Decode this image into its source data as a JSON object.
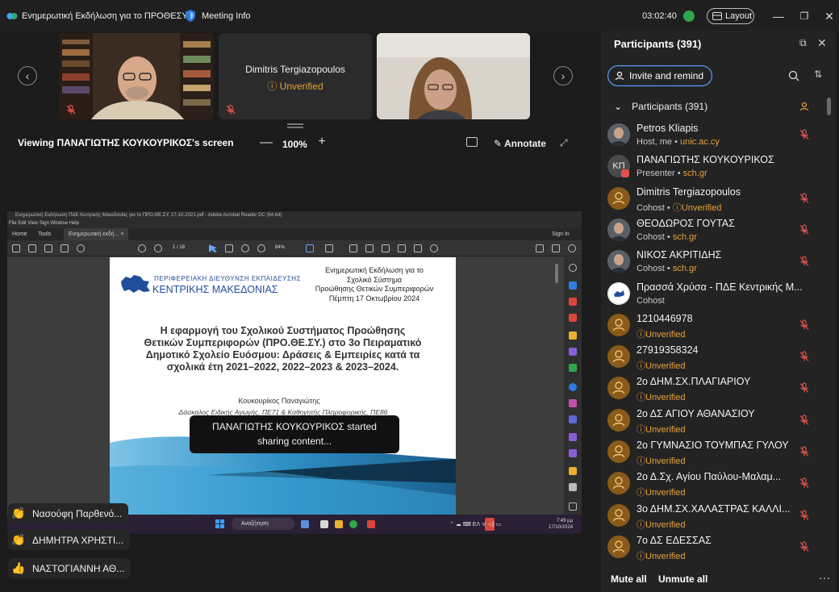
{
  "titlebar": {
    "app_title": "Ενημερωτική Εκδήλωση για το ΠΡΟΘΕΣΥ",
    "meeting_info": "Meeting Info",
    "timer": "03:02:40",
    "layout_label": "Layout",
    "minimize": "—",
    "maximize": "❐",
    "close": "✕"
  },
  "video_strip": {
    "prev_arrow": "‹",
    "next_arrow": "›",
    "tiles": [
      {
        "name": "",
        "muted": true
      },
      {
        "name": "Dimitris Tergiazopoulos",
        "status": "Unverified",
        "muted": true
      },
      {
        "name": "",
        "muted": false
      }
    ]
  },
  "viewing_bar": {
    "label": "Viewing ΠΑΝΑΓΙΩΤΗΣ ΚΟΥΚΟΥΡΙΚΟΣ's screen",
    "zoom_minus": "—",
    "zoom_value": "100%",
    "zoom_plus": "+",
    "annotate": "Annotate",
    "expand": "⤢"
  },
  "shared_screen": {
    "window_title": "Ενημερωτική Εκδήλωση ΠΔΕ Κεντρικής Μακεδονίας για το ΠΡΟ.ΘΕ.ΣΥ. 17-10-2021.pdf - Adobe Acrobat Reader DC (64-bit)",
    "menu": "File  Edit  View  Sign  Window  Help",
    "tabs": [
      "Home",
      "Tools",
      "Ενημερωτική εκδή..."
    ],
    "tab_close": "×",
    "sign_in": "Sign In",
    "page_indicator": "1  /  18",
    "zoom": "84%",
    "slide": {
      "region_line1": "ΠΕΡΙΦΕΡΕΙΑΚΗ ΔΙΕΥΘΥΝΣΗ ΕΚΠΑΙΔΕΥΣΗΣ",
      "region_line2": "ΚΕΝΤΡΙΚΗΣ ΜΑΚΕΔΟΝΙΑΣ",
      "event_lines": [
        "Ενημερωτική Εκδήλωση για το",
        "Σχολικό Σύστημα",
        "Προώθησης Θετικών Συμπεριφορών",
        "Πέμπτη 17 Οκτωβρίου 2024"
      ],
      "heading_lines": [
        "Η εφαρμογή του Σχολικού Συστήματος Προώθησης",
        "Θετικών Συμπεριφορών (ΠΡΟ.ΘΕ.ΣΥ.) στο 3ο Πειραματικό",
        "Δημοτικό Σχολείο Ευόσμου: Δράσεις & Εμπειρίες κατά τα",
        "σχολικά έτη 2021–2022, 2022–2023 & 2023–2024."
      ],
      "author": "Κουκουρίκος Παναγιώτης",
      "role": "Δάσκαλος Ειδικής Αγωγής, ΠΕ71 & Καθηγητής Πληροφορικής, ΠΕ86"
    },
    "toast": [
      "ΠΑΝΑΓΙΩΤΗΣ ΚΟΥΚΟΥΡΙΚΟΣ started",
      "sharing content..."
    ],
    "taskbar": {
      "search": "Αναζήτηση",
      "tray": "⌃  ☁  ⌨  ΕΛ   ᯤ  ◁)  ▭",
      "clock_time": "7:49 μμ",
      "clock_date": "17/10/2024"
    }
  },
  "reactions": [
    {
      "emoji": "👏",
      "name": "Νασούφη Παρθενό..."
    },
    {
      "emoji": "👏",
      "name": "ΔΗΜΗΤΡΑ ΧΡΗΣΤΙ..."
    },
    {
      "emoji": "👍",
      "name": "ΝΑΣΤΟΓΙΑΝΝΗ ΑΘ..."
    }
  ],
  "participants_panel": {
    "title": "Participants (391)",
    "popout": "⧉",
    "close": "✕",
    "invite_label": "Invite and remind",
    "sort": "⇅",
    "group_chevron": "⌄",
    "group_label": "Participants (391)",
    "participants": [
      {
        "name": "Petros Kliapis",
        "role": "Host, me",
        "domain": "unic.ac.cy",
        "avatar": "photo",
        "muted": true
      },
      {
        "name": "ΠΑΝΑΓΙΩΤΗΣ ΚΟΥΚΟΥΡΙΚΟΣ",
        "role": "Presenter",
        "domain": "sch.gr",
        "avatar": "kp",
        "initials": "ΚΠ",
        "muted": false
      },
      {
        "name": "Dimitris Tergiazopoulos",
        "role": "Cohost",
        "status": "Unverified",
        "avatar": "guest",
        "muted": true
      },
      {
        "name": "ΘΕΟΔΩΡΟΣ ΓΟΥΤΑΣ",
        "role": "Cohost",
        "domain": "sch.gr",
        "avatar": "photo",
        "muted": true
      },
      {
        "name": "ΝΙΚΟΣ ΑΚΡΙΤΙΔΗΣ",
        "role": "Cohost",
        "domain": "sch.gr",
        "avatar": "photo",
        "muted": true
      },
      {
        "name": "Πρασσά Χρύσα - ΠΔΕ Κεντρικής Μ...",
        "role": "Cohost",
        "avatar": "logo",
        "muted": false
      },
      {
        "name": "1210446978",
        "status": "Unverified",
        "avatar": "guest",
        "muted": true
      },
      {
        "name": "27919358324",
        "status": "Unverified",
        "avatar": "guest",
        "muted": true
      },
      {
        "name": "2ο ΔΗΜ.ΣΧ.ΠΛΑΓΙΑΡΙΟΥ",
        "status": "Unverified",
        "avatar": "guest",
        "muted": true
      },
      {
        "name": "2ο ΔΣ ΑΓΙΟΥ ΑΘΑΝΑΣΙΟΥ",
        "status": "Unverified",
        "avatar": "guest",
        "muted": true
      },
      {
        "name": "2ο ΓΥΜΝΑΣΙΟ ΤΟΥΜΠΑΣ ΓΥΛΟΥ",
        "status": "Unverified",
        "avatar": "guest",
        "muted": true
      },
      {
        "name": "2ο Δ.Σχ. Αγίου Παύλου-Μαλαμ...",
        "status": "Unverified",
        "avatar": "guest",
        "muted": true
      },
      {
        "name": "3ο ΔΗΜ.ΣΧ.ΧΑΛΑΣΤΡΑΣ ΚΑΛΛΙ...",
        "status": "Unverified",
        "avatar": "guest",
        "muted": true
      },
      {
        "name": "7ο ΔΣ ΕΔΕΣΣΑΣ",
        "status": "Unverified",
        "avatar": "guest",
        "muted": true
      }
    ],
    "mute_all": "Mute all",
    "unmute_all": "Unmute all",
    "more": "···"
  },
  "colors": {
    "accent_blue": "#64a0ff",
    "unverified_orange": "#e8a33b",
    "muted_red": "#e0524f",
    "guest_avatar": "#8a5a19"
  }
}
